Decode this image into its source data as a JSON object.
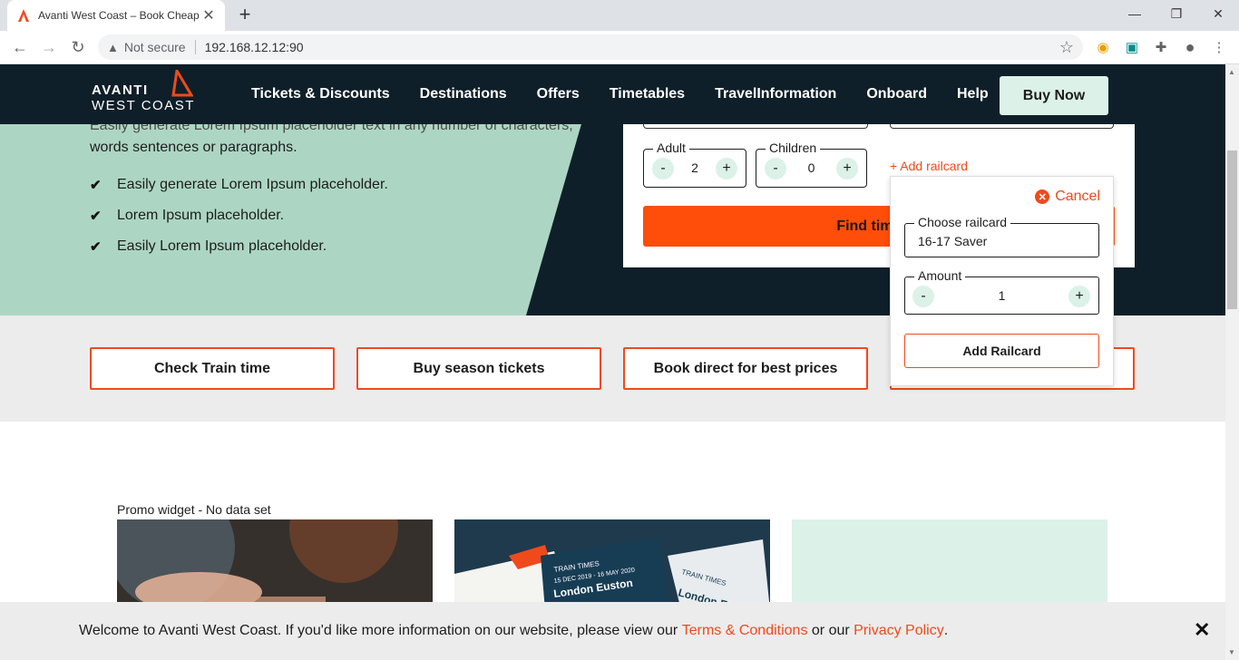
{
  "browser": {
    "tab_title": "Avanti West Coast – Book Cheap",
    "security_label": "Not secure",
    "url": "192.168.12.12:90"
  },
  "header": {
    "logo_line1": "AVANTI",
    "logo_line2": "WEST COAST",
    "nav": [
      "Tickets & Discounts",
      "Destinations",
      "Offers",
      "Timetables",
      "TravelInformation",
      "Onboard",
      "Help"
    ],
    "buy_now": "Buy Now"
  },
  "hero": {
    "text_line1": "Easily generate Lorem Ipsum placeholder text in any number of characters,",
    "text_line2": "words sentences or paragraphs.",
    "bullets": [
      "Easily generate Lorem Ipsum placeholder.",
      "Lorem Ipsum placeholder.",
      "Easily Lorem Ipsum placeholder."
    ]
  },
  "booking": {
    "adult_label": "Adult",
    "adult_value": "2",
    "children_label": "Children",
    "children_value": "0",
    "add_railcard": "+ Add railcard",
    "find_button": "Find times a"
  },
  "railcard_panel": {
    "cancel": "Cancel",
    "choose_label": "Choose railcard",
    "choose_value": "16-17 Saver",
    "amount_label": "Amount",
    "amount_value": "1",
    "add_button": "Add Railcard"
  },
  "actions": [
    "Check Train time",
    "Buy season tickets",
    "Book direct for best prices"
  ],
  "promo": {
    "label": "Promo widget - No data set",
    "ticket_heading": "TRAIN TIMES",
    "ticket_dates": "15 DEC 2019 - 16 MAY 2020",
    "ticket_station": "London Euston"
  },
  "cookie": {
    "text": "Welcome to Avanti West Coast. If you'd like more information on our website, please view our",
    "terms": "Terms & Conditions",
    "or": "or our",
    "privacy": "Privacy Policy",
    "end": "."
  },
  "colors": {
    "brand_orange": "#ef4a1c",
    "navy": "#0f1f29",
    "mint": "#acd6c3"
  }
}
